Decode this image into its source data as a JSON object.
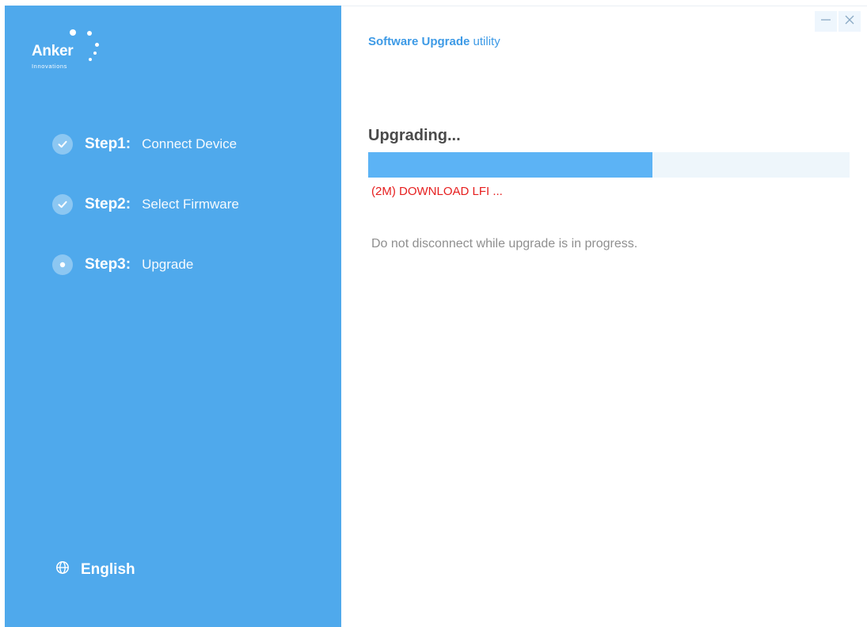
{
  "brand": {
    "name": "Anker",
    "tagline": "Innovations"
  },
  "app_title": {
    "bold": "Software Upgrade",
    "rest": "utility"
  },
  "steps": [
    {
      "num": "Step1:",
      "label": "Connect Device",
      "state": "done"
    },
    {
      "num": "Step2:",
      "label": "Select Firmware",
      "state": "done"
    },
    {
      "num": "Step3:",
      "label": "Upgrade",
      "state": "current"
    }
  ],
  "language": {
    "label": "English",
    "icon": "globe-icon"
  },
  "window_controls": {
    "minimize_icon": "minimize-icon",
    "close_icon": "close-icon"
  },
  "status": {
    "title": "Upgrading...",
    "progress_fraction": 0.59,
    "message": "(2M) DOWNLOAD LFI ...",
    "warning": "Do not disconnect while upgrade is in progress."
  },
  "colors": {
    "sidebar": "#4fa9ec",
    "accent": "#3d9ae6",
    "progress_fill": "#5cb3f5",
    "progress_track": "#eef6fb",
    "error_text": "#e61e1e"
  }
}
